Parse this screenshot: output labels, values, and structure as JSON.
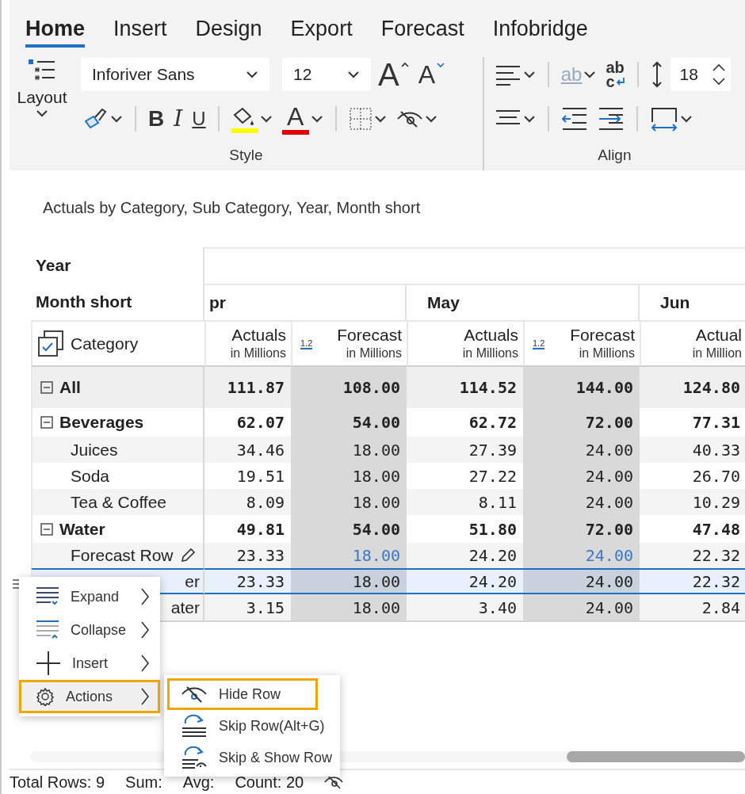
{
  "ribbon": {
    "tabs": [
      {
        "label": "Home",
        "selected": true
      },
      {
        "label": "Insert",
        "selected": false
      },
      {
        "label": "Design",
        "selected": false
      },
      {
        "label": "Export",
        "selected": false
      },
      {
        "label": "Forecast",
        "selected": false
      },
      {
        "label": "Infobridge",
        "selected": false
      }
    ],
    "layout_button": {
      "label": "Layout"
    },
    "font_select": {
      "value": "Inforiver Sans"
    },
    "size_select": {
      "value": "12"
    },
    "style_row1": [
      {
        "kind": "grow",
        "label": "A"
      },
      {
        "kind": "shrink",
        "label": "A"
      }
    ],
    "style_row2": [
      [
        {
          "kind": "brush",
          "dropdown": true
        }
      ],
      [
        {
          "kind": "bold",
          "label": "B"
        },
        {
          "kind": "italic",
          "label": "I"
        },
        {
          "kind": "underline",
          "label": "U"
        }
      ],
      [
        {
          "kind": "fill",
          "color": "#ffff00",
          "dropdown": true
        },
        {
          "kind": "font-color",
          "label": "A",
          "color": "#e00000",
          "dropdown": true
        }
      ],
      [
        {
          "kind": "borders",
          "dropdown": true
        },
        {
          "kind": "hide",
          "dropdown": true
        }
      ]
    ],
    "style_group": "Style",
    "align_row1": [
      [
        {
          "kind": "align-left",
          "dropdown": true
        }
      ],
      [
        {
          "kind": "text-ab",
          "label": "ab",
          "disabled": true,
          "dropdown": true
        },
        {
          "kind": "wrap",
          "label": "ab",
          "sub": "c"
        }
      ],
      [
        {
          "kind": "line-height"
        }
      ]
    ],
    "line_height": {
      "value": "18"
    },
    "align_row2": [
      [
        {
          "kind": "align-center",
          "dropdown": true
        }
      ],
      [
        {
          "kind": "outdent"
        },
        {
          "kind": "indent"
        }
      ],
      [
        {
          "kind": "box-width",
          "dropdown": true
        }
      ]
    ],
    "align_group": "Align"
  },
  "report": {
    "title": "Actuals by Category, Sub Category, Year, Month short",
    "year_label": "Year",
    "month_label": "Month short",
    "category_label": "Category",
    "months": [
      {
        "label": "pr",
        "columns": [
          {
            "kind": "actual",
            "title": "Actuals",
            "unit": "in Millions"
          },
          {
            "kind": "forecast",
            "title": "Forecast",
            "unit": "in Millions",
            "badge": "1.2"
          }
        ]
      },
      {
        "label": "May",
        "columns": [
          {
            "kind": "actual",
            "title": "Actuals",
            "unit": "in Millions"
          },
          {
            "kind": "forecast",
            "title": "Forecast",
            "unit": "in Millions",
            "badge": "1.2"
          }
        ]
      },
      {
        "label": "Jun",
        "columns": [
          {
            "kind": "actual",
            "title": "Actual",
            "unit": "in Million"
          }
        ]
      }
    ],
    "rows": [
      {
        "label": "All",
        "kind": "total",
        "expanded": true,
        "selected": false,
        "values": [
          "111.87",
          "108.00",
          "114.52",
          "144.00",
          "124.80"
        ]
      },
      {
        "label": "Beverages",
        "kind": "group",
        "expanded": true,
        "selected": false,
        "values": [
          "62.07",
          "54.00",
          "62.72",
          "72.00",
          "77.31"
        ]
      },
      {
        "label": "Juices",
        "kind": "item",
        "selected": false,
        "values": [
          "34.46",
          "18.00",
          "27.39",
          "24.00",
          "40.33"
        ]
      },
      {
        "label": "Soda",
        "kind": "item",
        "selected": false,
        "values": [
          "19.51",
          "18.00",
          "27.22",
          "24.00",
          "26.70"
        ]
      },
      {
        "label": "Tea & Coffee",
        "kind": "item",
        "selected": false,
        "values": [
          "8.09",
          "18.00",
          "8.11",
          "24.00",
          "10.29"
        ]
      },
      {
        "label": "Water",
        "kind": "group",
        "expanded": true,
        "selected": false,
        "values": [
          "49.81",
          "54.00",
          "51.80",
          "72.00",
          "47.48"
        ]
      },
      {
        "label": "Forecast Row",
        "kind": "forecast",
        "selected": false,
        "values": [
          "23.33",
          "18.00",
          "24.20",
          "24.00",
          "22.32"
        ]
      },
      {
        "label": "er",
        "kind": "covered",
        "selected": true,
        "values": [
          "23.33",
          "18.00",
          "24.20",
          "24.00",
          "22.32"
        ]
      },
      {
        "label": "ater",
        "kind": "covered",
        "selected": false,
        "values": [
          "3.15",
          "18.00",
          "3.40",
          "24.00",
          "2.84"
        ]
      }
    ]
  },
  "context_menu": {
    "items": [
      {
        "kind": "expand",
        "label": "Expand",
        "selected": false
      },
      {
        "kind": "collapse",
        "label": "Collapse",
        "selected": false
      },
      {
        "kind": "insert",
        "label": "Insert",
        "selected": false
      },
      {
        "kind": "actions",
        "label": "Actions",
        "selected": true
      }
    ],
    "submenu": [
      {
        "kind": "hide",
        "label": "Hide Row",
        "selected": true
      },
      {
        "kind": "skip",
        "label": "Skip Row(Alt+G)",
        "selected": false
      },
      {
        "kind": "skip-show",
        "label": "Skip & Show Row",
        "selected": false
      }
    ]
  },
  "status_bar": {
    "items": [
      "Total Rows: 9",
      "Sum:",
      "Avg:",
      "Count: 20"
    ]
  }
}
